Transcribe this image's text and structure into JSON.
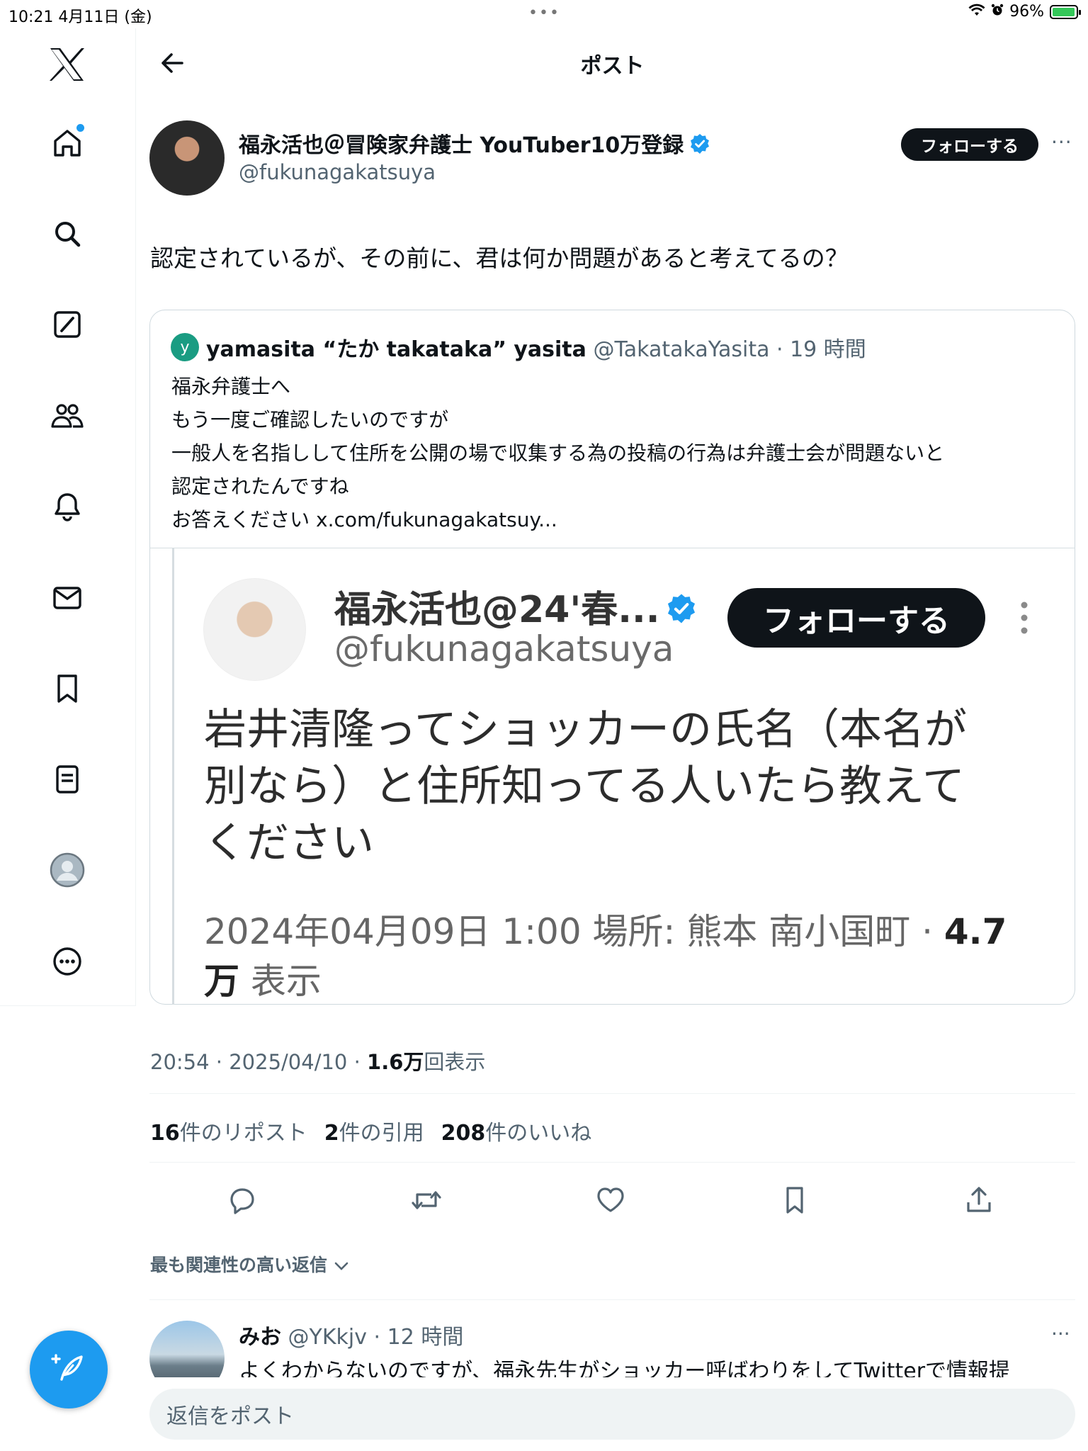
{
  "status_bar": {
    "time_date": "10:21   4月11日 (金)",
    "dots": "•••",
    "battery": "96%",
    "battery_level": 0.96,
    "battery_color": "#34c759"
  },
  "colors": {
    "accent": "#1d9bf0",
    "text": "#0f1419",
    "secondary": "#536471"
  },
  "sidebar": {
    "items": [
      {
        "icon": "x-logo-icon"
      },
      {
        "icon": "home-icon",
        "has_dot": true
      },
      {
        "icon": "search-icon"
      },
      {
        "icon": "grok-icon"
      },
      {
        "icon": "communities-icon"
      },
      {
        "icon": "bell-icon"
      },
      {
        "icon": "mail-icon"
      },
      {
        "icon": "bookmark-icon"
      },
      {
        "icon": "lists-icon"
      },
      {
        "icon": "profile-icon"
      },
      {
        "icon": "more-icon"
      }
    ],
    "compose_icon": "compose-feather-icon"
  },
  "header": {
    "title": "ポスト"
  },
  "post": {
    "author_name": "福永活也＠冒険家弁護士 YouTuber10万登録",
    "author_handle": "@fukunagakatsuya",
    "follow_label": "フォローする",
    "more": "···",
    "text": "認定されているが、その前に、君は何か問題があると考えてるの？",
    "time": "20:54 · 2025/04/10 · ",
    "views_count": "1.6万",
    "views_label": "回表示"
  },
  "quote": {
    "avatar_letter": "y",
    "name": "yamasita “たか takataka” yasita",
    "handle_time": "@TakatakaYasita · 19 時間",
    "lines": [
      "福永弁護士へ",
      "もう一度ご確認したいのですが",
      "一般人を名指しして住所を公開の場で収集する為の投稿の行為は弁護士会が問題ないと",
      "認定されたんですね",
      "お答えください x.com/fukunagakatsuy..."
    ]
  },
  "embed": {
    "name": "福永活也@24'春...",
    "handle": "@fukunagakatsuya",
    "follow_label": "フォローする",
    "lines": [
      "岩井清隆ってショッカーの氏名（本名が",
      "別なら）と住所知ってる人いたら教えて",
      "ください"
    ],
    "meta_line1_a": "2024年04月09日 1:00 場所: 熊本 南小国町 · ",
    "meta_line1_b": "4.7",
    "meta_line2_a": "万",
    "meta_line2_b": " 表示"
  },
  "stats": {
    "reposts_count": "16",
    "reposts_label": "件のリポスト",
    "quotes_count": "2",
    "quotes_label": "件の引用",
    "likes_count": "208",
    "likes_label": "件のいいね"
  },
  "actions": [
    "reply-icon",
    "repost-icon",
    "like-icon",
    "bookmark-icon",
    "share-icon"
  ],
  "replies": {
    "sort_label": "最も関連性の高い返信",
    "items": [
      {
        "name": "みお",
        "handle_time": "@YKkjv · 12 時間",
        "text": "よくわからないのですが、福永先生がショッカー呼ばわりをしてTwitterで情報提",
        "more": "···"
      }
    ]
  },
  "reply_box": {
    "placeholder": "返信をポスト"
  }
}
